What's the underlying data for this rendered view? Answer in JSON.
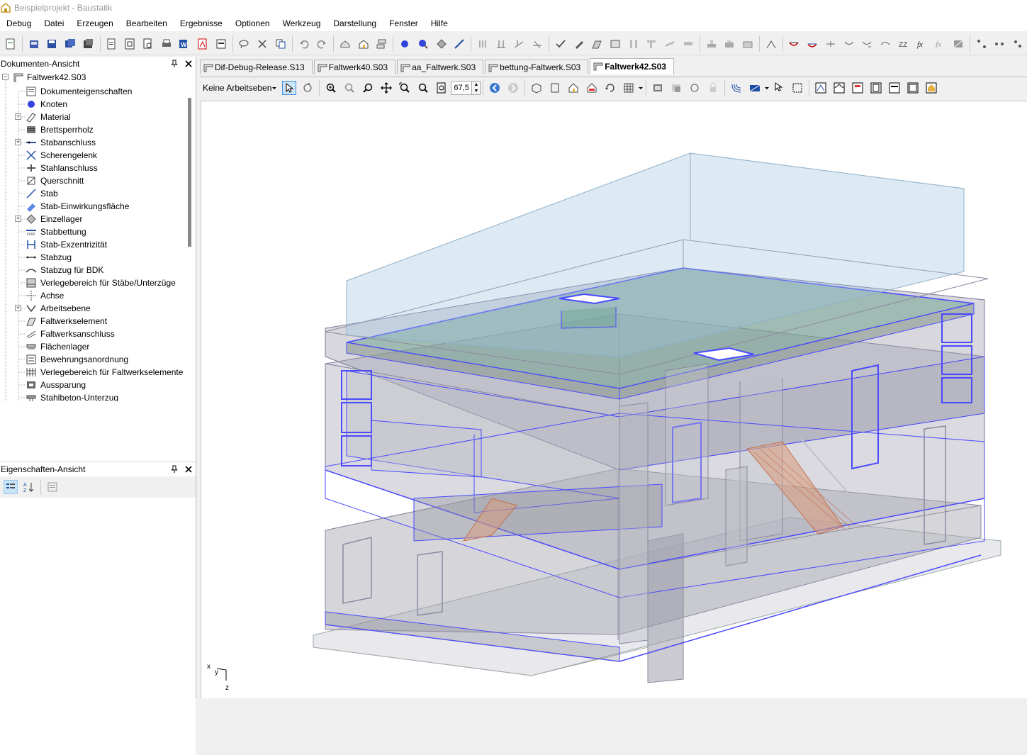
{
  "window": {
    "title": "Beispielprojekt - Baustatik"
  },
  "menu": [
    "Debug",
    "Datei",
    "Erzeugen",
    "Bearbeiten",
    "Ergebnisse",
    "Optionen",
    "Werkzeug",
    "Darstellung",
    "Fenster",
    "Hilfe"
  ],
  "documents_panel": {
    "title": "Dokumenten-Ansicht",
    "root": "Faltwerk42.S03",
    "items": [
      {
        "label": "Dokumenteigenschaften",
        "icon": "document-properties-icon",
        "expandable": false
      },
      {
        "label": "Knoten",
        "icon": "node-icon",
        "expandable": false
      },
      {
        "label": "Material",
        "icon": "material-icon",
        "expandable": true
      },
      {
        "label": "Brettsperrholz",
        "icon": "clt-icon",
        "expandable": false
      },
      {
        "label": "Stabanschluss",
        "icon": "member-connection-icon",
        "expandable": true
      },
      {
        "label": "Scherengelenk",
        "icon": "scissor-joint-icon",
        "expandable": false
      },
      {
        "label": "Stahlanschluss",
        "icon": "steel-connection-icon",
        "expandable": false
      },
      {
        "label": "Querschnitt",
        "icon": "cross-section-icon",
        "expandable": false
      },
      {
        "label": "Stab",
        "icon": "member-icon",
        "expandable": false
      },
      {
        "label": "Stab-Einwirkungsfläche",
        "icon": "member-load-area-icon",
        "expandable": false
      },
      {
        "label": "Einzellager",
        "icon": "single-support-icon",
        "expandable": true
      },
      {
        "label": "Stabbettung",
        "icon": "member-bedding-icon",
        "expandable": false
      },
      {
        "label": "Stab-Exzentrizität",
        "icon": "member-eccentricity-icon",
        "expandable": false
      },
      {
        "label": "Stabzug",
        "icon": "member-chain-icon",
        "expandable": false
      },
      {
        "label": "Stabzug für BDK",
        "icon": "member-chain-bdk-icon",
        "expandable": false
      },
      {
        "label": "Verlegebereich für Stäbe/Unterzüge",
        "icon": "laying-area-members-icon",
        "expandable": false
      },
      {
        "label": "Achse",
        "icon": "axis-icon",
        "expandable": false
      },
      {
        "label": "Arbeitsebene",
        "icon": "work-plane-icon",
        "expandable": true
      },
      {
        "label": "Faltwerkselement",
        "icon": "folded-plate-element-icon",
        "expandable": false
      },
      {
        "label": "Faltwerksanschluss",
        "icon": "folded-plate-connection-icon",
        "expandable": false
      },
      {
        "label": "Flächenlager",
        "icon": "area-support-icon",
        "expandable": false
      },
      {
        "label": "Bewehrungsanordnung",
        "icon": "reinforcement-icon",
        "expandable": false
      },
      {
        "label": "Verlegebereich für Faltwerkselemente",
        "icon": "laying-area-plates-icon",
        "expandable": false
      },
      {
        "label": "Aussparung",
        "icon": "opening-icon",
        "expandable": false
      },
      {
        "label": "Stahlbeton-Unterzug",
        "icon": "rc-beam-icon",
        "expandable": false
      }
    ]
  },
  "properties_panel": {
    "title": "Eigenschaften-Ansicht"
  },
  "tabs": [
    {
      "label": "Dif-Debug-Release.S13",
      "active": false
    },
    {
      "label": "Faltwerk40.S03",
      "active": false
    },
    {
      "label": "aa_Faltwerk.S03",
      "active": false
    },
    {
      "label": "bettung-Faltwerk.S03",
      "active": false
    },
    {
      "label": "Faltwerk42.S03",
      "active": true
    }
  ],
  "view_toolbar": {
    "workplane": "Keine Arbeitseben",
    "zoom": "67,5"
  },
  "axes": {
    "x": "x",
    "y": "y",
    "z": "z"
  },
  "colors": {
    "edge": "#4a4aff",
    "fill": "#9a9aa8",
    "top": "#9fc4dc",
    "slab": "#6aa08a",
    "stair": "#d99a7a"
  }
}
